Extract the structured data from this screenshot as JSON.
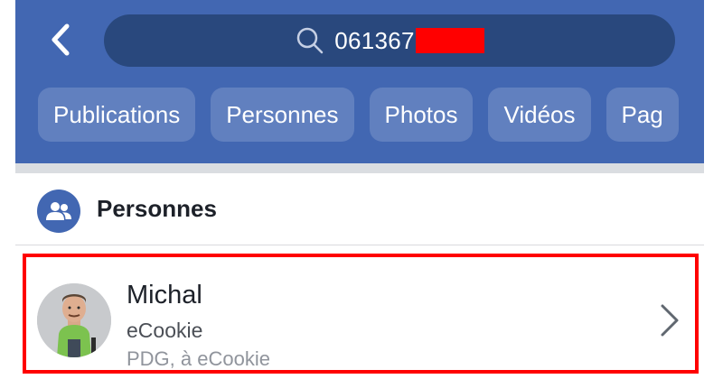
{
  "search": {
    "query_visible": "061367",
    "redacted": true
  },
  "filters": [
    {
      "label": "Publications"
    },
    {
      "label": "Personnes"
    },
    {
      "label": "Photos"
    },
    {
      "label": "Vidéos"
    },
    {
      "label": "Pag"
    }
  ],
  "section": {
    "title": "Personnes",
    "icon": "people-icon"
  },
  "result": {
    "name": "Michal",
    "line1": "eCookie",
    "line2": "PDG, à eCookie"
  },
  "colors": {
    "header_bg": "#4267b2",
    "search_bg": "#29487d",
    "highlight": "#ff0000",
    "separator": "#dadde1"
  }
}
